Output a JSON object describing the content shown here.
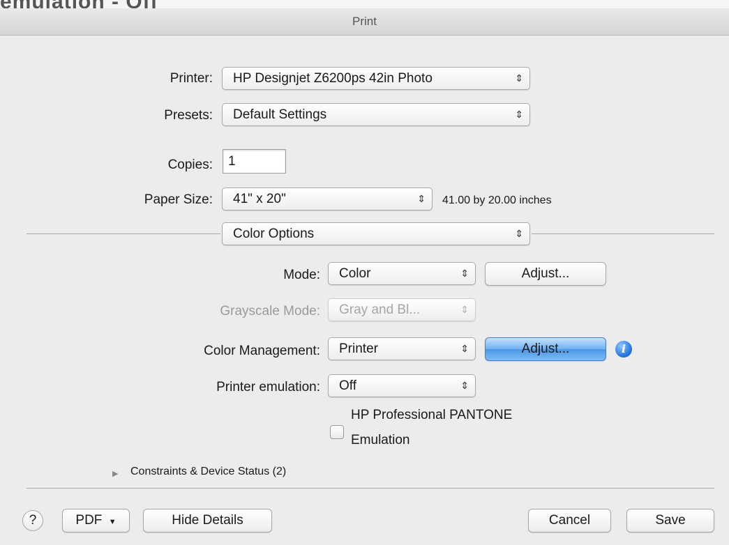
{
  "window": {
    "title": "Print",
    "background_fragment": "emulation - Off"
  },
  "form": {
    "printer": {
      "label": "Printer:",
      "value": "HP Designjet Z6200ps 42in Photo"
    },
    "presets": {
      "label": "Presets:",
      "value": "Default Settings"
    },
    "copies": {
      "label": "Copies:",
      "value": "1"
    },
    "paper_size": {
      "label": "Paper Size:",
      "value": "41\" x 20\"",
      "description": "41.00 by 20.00 inches"
    }
  },
  "section": {
    "value": "Color Options"
  },
  "options": {
    "mode": {
      "label": "Mode:",
      "value": "Color",
      "adjust_label": "Adjust..."
    },
    "grayscale_mode": {
      "label": "Grayscale Mode:",
      "value": "Gray and Bl..."
    },
    "color_management": {
      "label": "Color Management:",
      "value": "Printer",
      "adjust_label": "Adjust..."
    },
    "printer_emulation": {
      "label": "Printer emulation:",
      "value": "Off"
    },
    "pantone": {
      "label_line1": "HP Professional PANTONE",
      "label_line2": "Emulation",
      "checked": false
    }
  },
  "constraints": {
    "label": "Constraints & Device Status (2)"
  },
  "footer": {
    "help": "?",
    "pdf": "PDF",
    "hide_details": "Hide Details",
    "cancel": "Cancel",
    "save": "Save"
  },
  "icons": {
    "popup_arrows": "updown-arrows-icon",
    "info": "info-icon",
    "disclosure": "disclosure-triangle-icon",
    "pdf_menu": "chevron-down-icon"
  },
  "colors": {
    "accent": "#4b96e6",
    "dialog_bg": "#ececec",
    "disabled_text": "#9a9a9a"
  }
}
